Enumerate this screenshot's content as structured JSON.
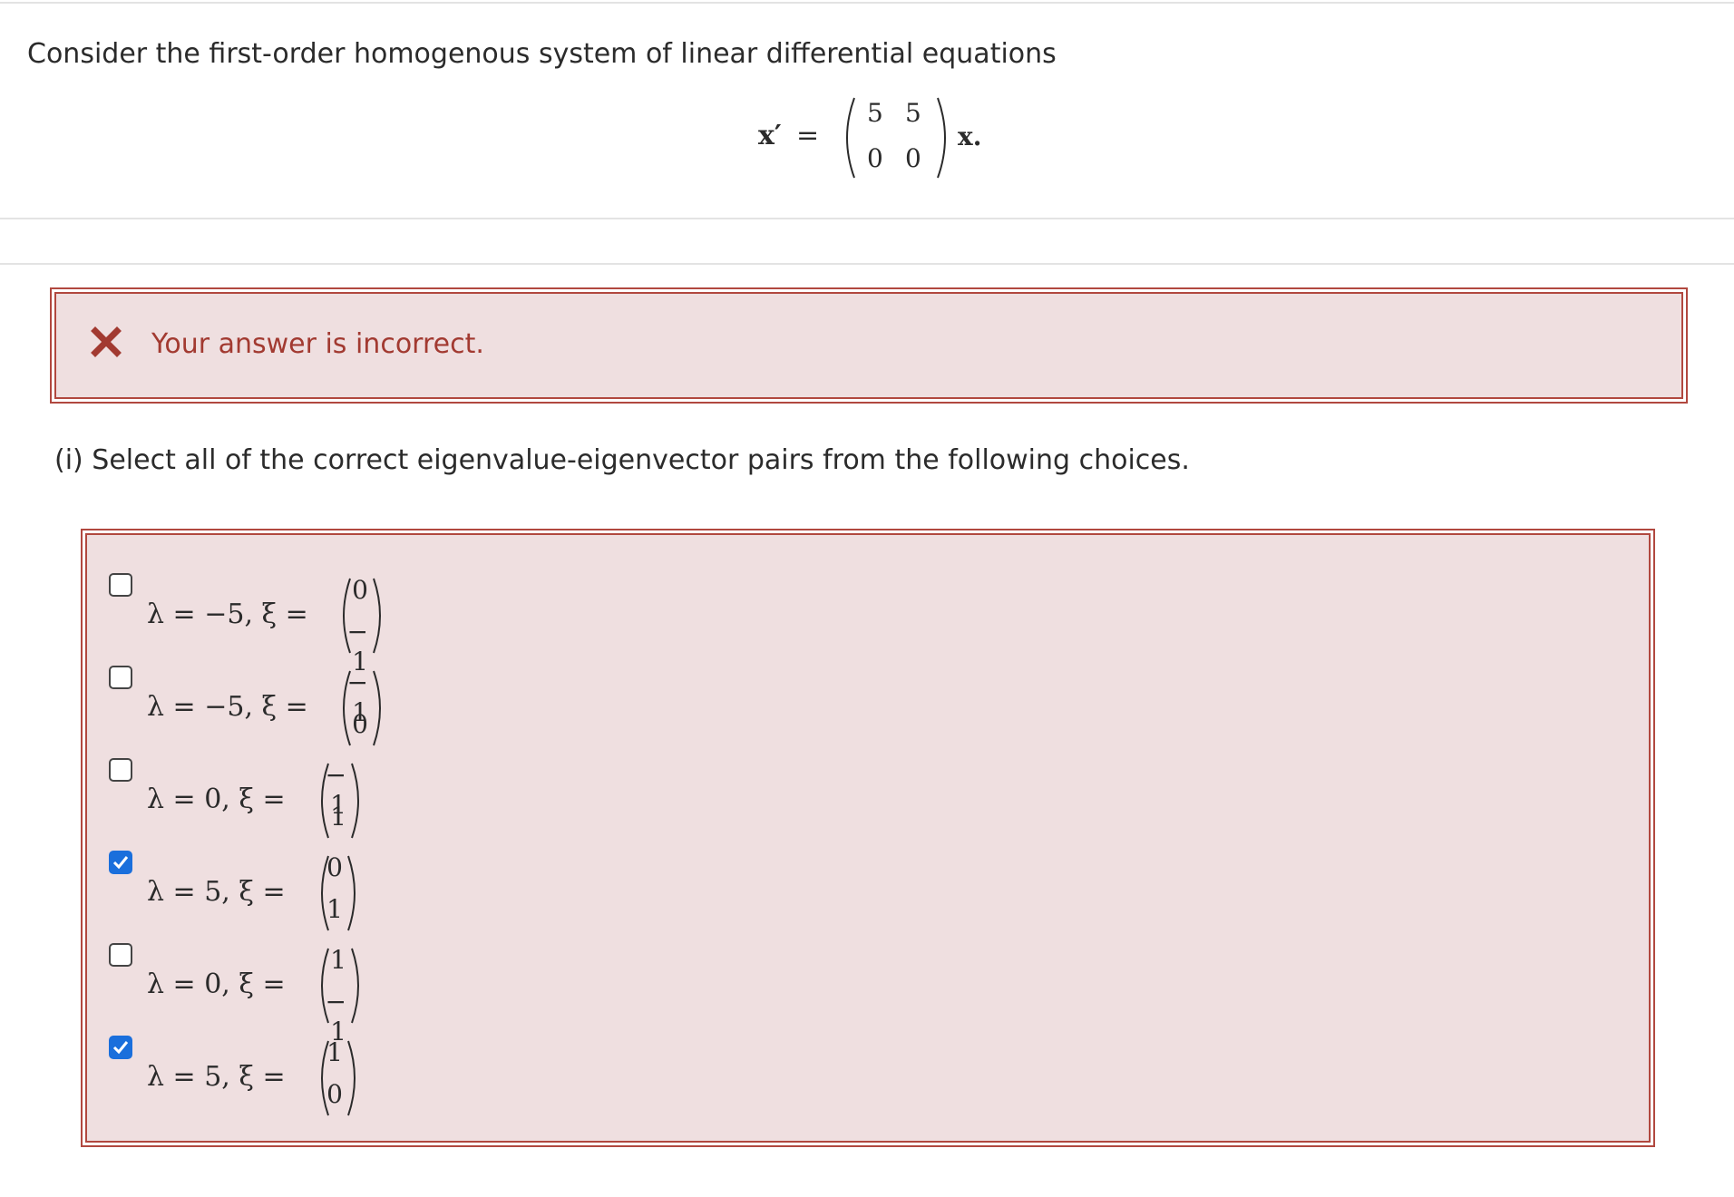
{
  "problem": {
    "intro": "Consider the first-order homogenous system of linear differential equations",
    "equation": {
      "lhs": "x′",
      "equals": "=",
      "matrix": [
        [
          "5",
          "5"
        ],
        [
          "0",
          "0"
        ]
      ],
      "rhs": "x."
    }
  },
  "feedback": {
    "icon": "x-icon",
    "message": "Your answer is incorrect.",
    "color": "#a23a31"
  },
  "question": {
    "text": "(i) Select all of the correct eigenvalue-eigenvector pairs from the following choices."
  },
  "choices": [
    {
      "lambda_text": "λ = −5, ξ =",
      "vector": [
        "0",
        "− 1"
      ],
      "checked": false
    },
    {
      "lambda_text": "λ = −5, ξ =",
      "vector": [
        "− 1",
        "0"
      ],
      "checked": false
    },
    {
      "lambda_text": "λ = 0, ξ =",
      "vector": [
        "− 1",
        "1"
      ],
      "checked": false
    },
    {
      "lambda_text": "λ = 5, ξ =",
      "vector": [
        "0",
        "1"
      ],
      "checked": true
    },
    {
      "lambda_text": "λ = 0, ξ =",
      "vector": [
        "1",
        "− 1"
      ],
      "checked": false
    },
    {
      "lambda_text": "λ = 5, ξ =",
      "vector": [
        "1",
        "0"
      ],
      "checked": true
    }
  ],
  "colors": {
    "error_border": "#b1483f",
    "error_background": "#efdfe0",
    "checkbox_checked": "#1a6fdc"
  }
}
